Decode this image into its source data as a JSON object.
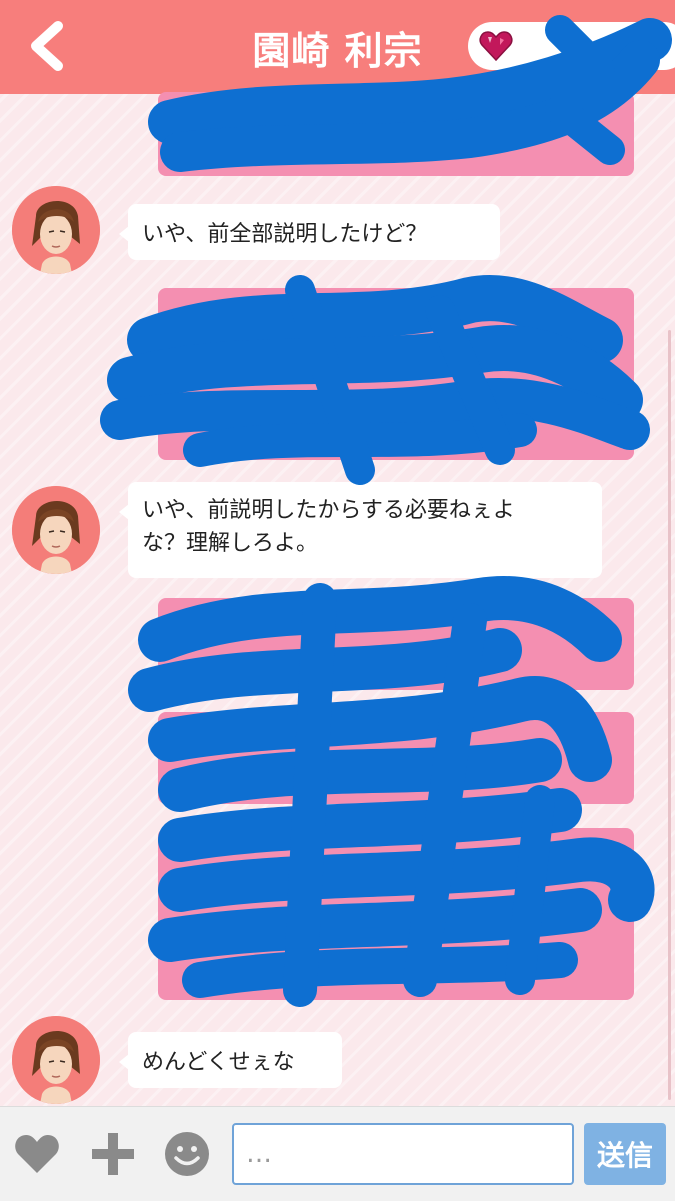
{
  "header": {
    "contact_name": "園崎 利宗",
    "back_icon": "chevron-left-icon",
    "gem_icon": "heart-gem-icon"
  },
  "messages": [
    {
      "from": "them",
      "text": "いや、前全部説明したけど？"
    },
    {
      "from": "them",
      "text": "いや、前説明したからする必要ねぇよな？理解しろよ。",
      "line1": "いや、前説明したからする必要ねぇよ",
      "line2": "な？理解しろよ。"
    },
    {
      "from": "them",
      "text": "めんどくせぇな"
    }
  ],
  "input_bar": {
    "placeholder": "…",
    "send_label": "送信",
    "icons": [
      "heart-icon",
      "plus-icon",
      "smiley-icon"
    ]
  },
  "colors": {
    "header": "#f77e7c",
    "outgoing_bubble": "#f48fb1",
    "scribble": "#0e6fd1",
    "send_button": "#7fb2e3"
  }
}
